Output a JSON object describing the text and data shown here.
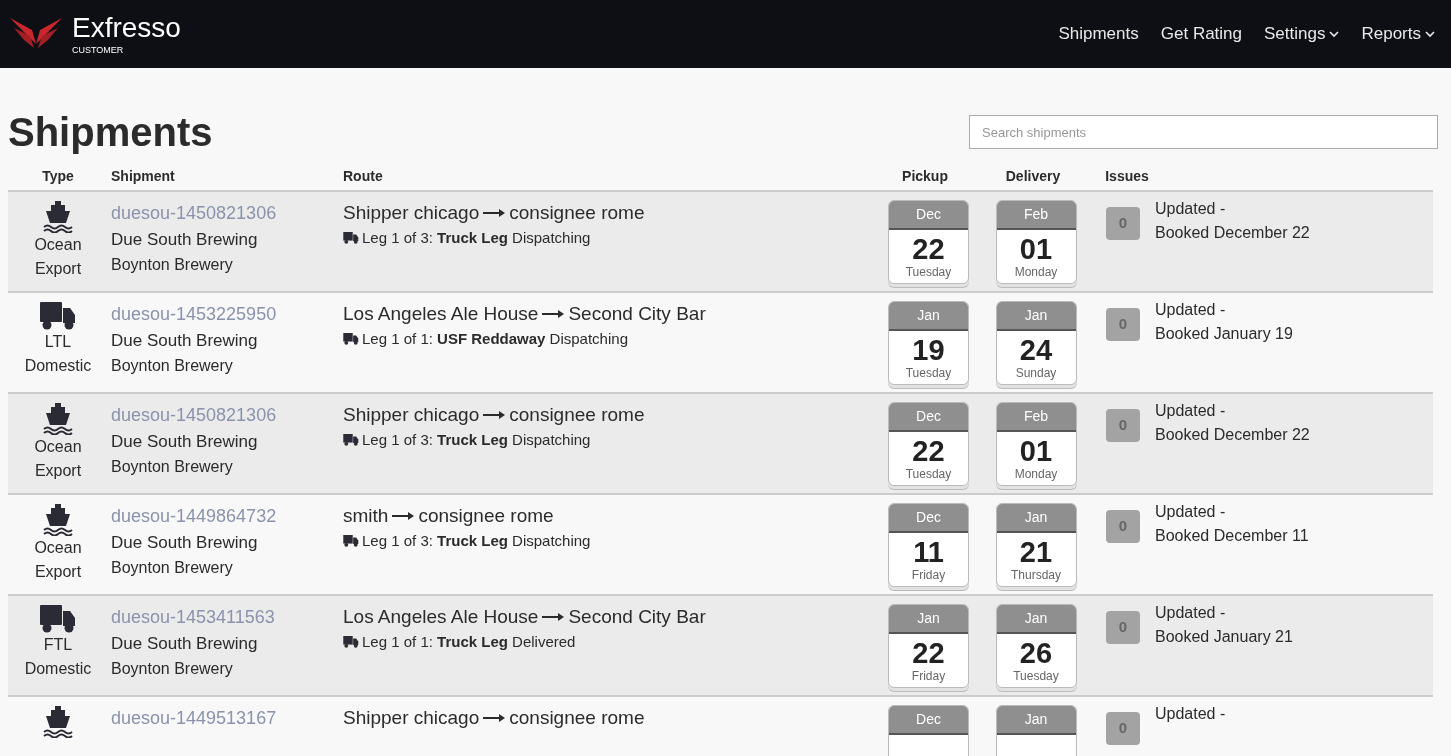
{
  "brand": {
    "name": "Exfresso",
    "subtitle": "CUSTOMER"
  },
  "nav": [
    {
      "label": "Shipments",
      "dropdown": false
    },
    {
      "label": "Get Rating",
      "dropdown": false
    },
    {
      "label": "Settings",
      "dropdown": true
    },
    {
      "label": "Reports",
      "dropdown": true
    }
  ],
  "page_title": "Shipments",
  "search": {
    "placeholder": "Search shipments"
  },
  "columns": [
    "Type",
    "Shipment",
    "Route",
    "Pickup",
    "Delivery",
    "Issues"
  ],
  "rows": [
    {
      "kind": "ship",
      "type": [
        "Ocean",
        "Export"
      ],
      "id": "duesou-1450821306",
      "customer": "Due South Brewing",
      "location": "Boynton Brewery",
      "route_from": "Shipper chicago",
      "route_to": "consignee rome",
      "leg": "Leg 1 of 3: **Truck Leg** Dispatching",
      "pickup": {
        "month": "Dec",
        "day": "22",
        "weekday": "Tuesday"
      },
      "delivery": {
        "month": "Feb",
        "day": "01",
        "weekday": "Monday"
      },
      "issues": "0",
      "updated": "Updated -",
      "booked": "Booked December 22"
    },
    {
      "kind": "truck",
      "type": [
        "LTL",
        "Domestic"
      ],
      "id": "duesou-1453225950",
      "customer": "Due South Brewing",
      "location": "Boynton Brewery",
      "route_from": "Los Angeles Ale House",
      "route_to": "Second City Bar",
      "leg": "Leg 1 of 1: **USF Reddaway** Dispatching",
      "pickup": {
        "month": "Jan",
        "day": "19",
        "weekday": "Tuesday"
      },
      "delivery": {
        "month": "Jan",
        "day": "24",
        "weekday": "Sunday"
      },
      "issues": "0",
      "updated": "Updated -",
      "booked": "Booked January 19"
    },
    {
      "kind": "ship",
      "type": [
        "Ocean",
        "Export"
      ],
      "id": "duesou-1450821306",
      "customer": "Due South Brewing",
      "location": "Boynton Brewery",
      "route_from": "Shipper chicago",
      "route_to": "consignee rome",
      "leg": "Leg 1 of 3: **Truck Leg** Dispatching",
      "pickup": {
        "month": "Dec",
        "day": "22",
        "weekday": "Tuesday"
      },
      "delivery": {
        "month": "Feb",
        "day": "01",
        "weekday": "Monday"
      },
      "issues": "0",
      "updated": "Updated -",
      "booked": "Booked December 22"
    },
    {
      "kind": "ship",
      "type": [
        "Ocean",
        "Export"
      ],
      "id": "duesou-1449864732",
      "customer": "Due South Brewing",
      "location": "Boynton Brewery",
      "route_from": "smith",
      "route_to": "consignee rome",
      "leg": "Leg 1 of 3: **Truck Leg** Dispatching",
      "pickup": {
        "month": "Dec",
        "day": "11",
        "weekday": "Friday"
      },
      "delivery": {
        "month": "Jan",
        "day": "21",
        "weekday": "Thursday"
      },
      "issues": "0",
      "updated": "Updated -",
      "booked": "Booked December 11"
    },
    {
      "kind": "truck",
      "type": [
        "FTL",
        "Domestic"
      ],
      "id": "duesou-1453411563",
      "customer": "Due South Brewing",
      "location": "Boynton Brewery",
      "route_from": "Los Angeles Ale House",
      "route_to": "Second City Bar",
      "leg": "Leg 1 of 1: **Truck Leg** Delivered",
      "pickup": {
        "month": "Jan",
        "day": "22",
        "weekday": "Friday"
      },
      "delivery": {
        "month": "Jan",
        "day": "26",
        "weekday": "Tuesday"
      },
      "issues": "0",
      "updated": "Updated -",
      "booked": "Booked January 21"
    },
    {
      "kind": "ship",
      "id": "duesou-1449513167",
      "route_from": "Shipper chicago",
      "route_to": "consignee rome",
      "pickup": {
        "month": "Dec"
      },
      "delivery": {
        "month": "Jan"
      },
      "issues": "0",
      "updated": "Updated -"
    }
  ]
}
